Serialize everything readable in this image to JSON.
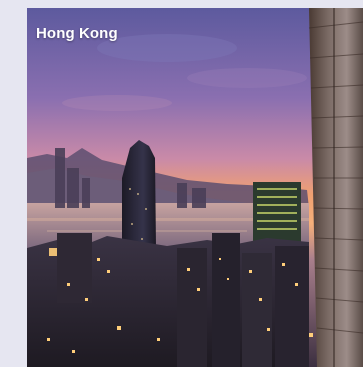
{
  "card": {
    "caption": "Hong Kong",
    "image_subject": "hong-kong-skyline-at-sunset"
  },
  "colors": {
    "page_background": "#e6e6f1",
    "caption_text": "#ffffff",
    "sky_top": "#6d62a8",
    "sky_horizon": "#f4a06a"
  }
}
